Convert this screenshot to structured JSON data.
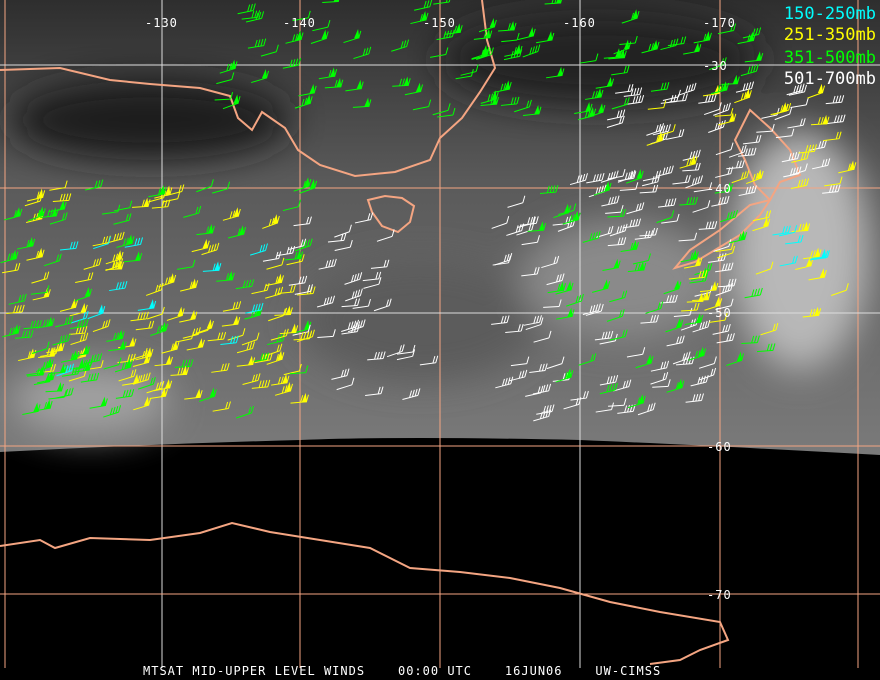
{
  "legend": [
    {
      "label": "150-250mb",
      "color": "#00ffff"
    },
    {
      "label": "251-350mb",
      "color": "#ffff00"
    },
    {
      "label": "351-500mb",
      "color": "#00ff00"
    },
    {
      "label": "501-700mb",
      "color": "#ffffff"
    }
  ],
  "longitude_labels": [
    "-130",
    "-140",
    "-150",
    "-160",
    "-170"
  ],
  "latitude_labels": [
    "-30",
    "-40",
    "-50",
    "-60",
    "-70"
  ],
  "footer": {
    "product": "MTSAT MID-UPPER LEVEL WINDS",
    "time": "00:00 UTC",
    "date": "16JUN06",
    "source": "UW-CIMSS"
  },
  "colors": {
    "coast": "#f4a582",
    "grid": "#f4a582"
  }
}
